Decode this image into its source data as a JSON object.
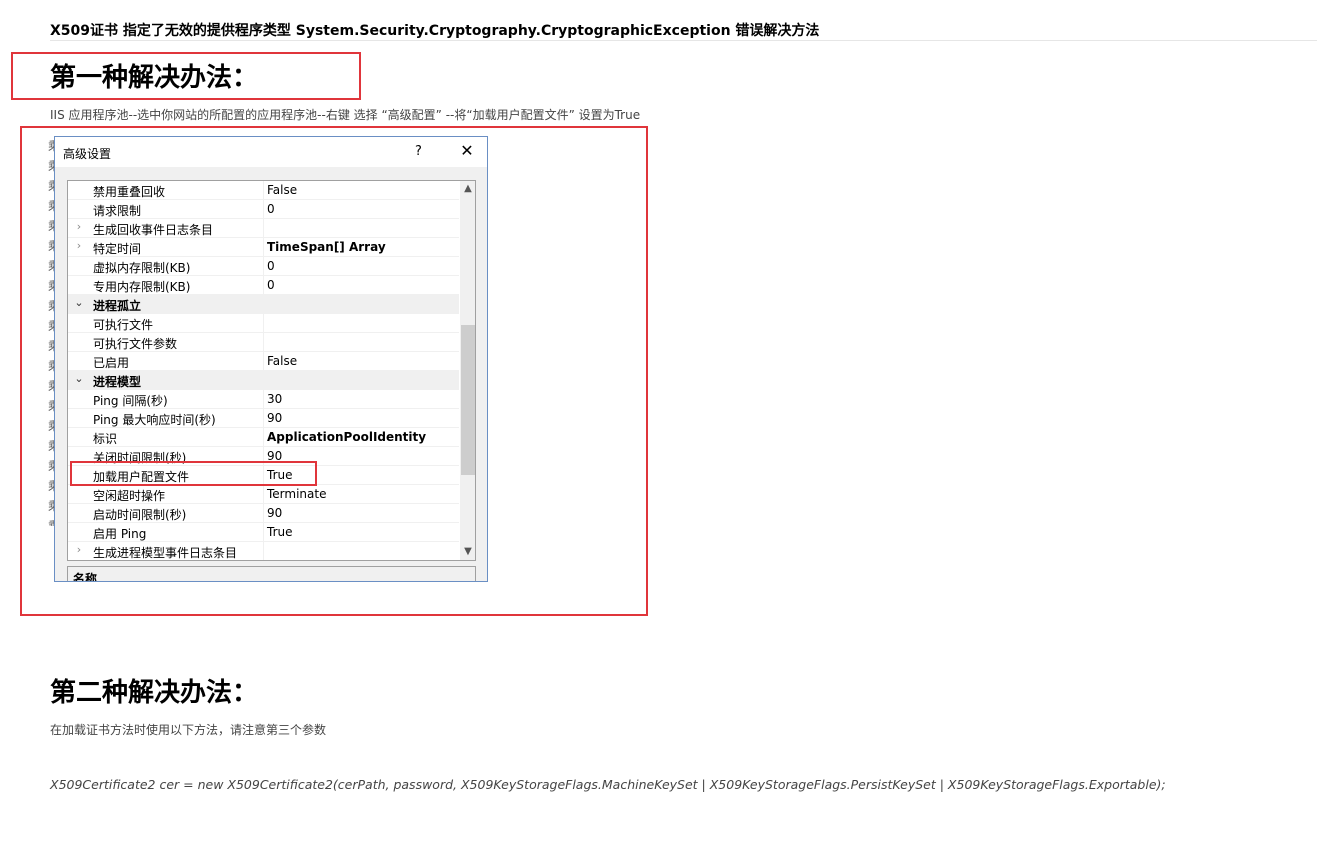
{
  "article": {
    "title": "X509证书 指定了无效的提供程序类型 System.Security.Cryptography.CryptographicException 错误解决方法",
    "section1_heading": "第一种解决办法：",
    "section1_text": "IIS 应用程序池--选中你网站的所配置的应用程序池--右键 选择 “高级配置” --将“加载用户配置文件” 设置为True",
    "section2_heading": "第二种解决办法：",
    "section2_text": "在加载证书方法时使用以下方法，请注意第三个参数",
    "code": "X509Certificate2 cer = new X509Certificate2(cerPath, password, X509KeyStorageFlags.MachineKeySet | X509KeyStorageFlags.PersistKeySet | X509KeyStorageFlags.Exportable);"
  },
  "background_chars": [
    "乘",
    "乘",
    "乘",
    "乘",
    "乘",
    "乘",
    "乘",
    "乘",
    "乘",
    "乘",
    "乘",
    "乘",
    "乘",
    "乘",
    "乘",
    "乘",
    "乘",
    "乘",
    "乘",
    "乘"
  ],
  "dialog": {
    "title": "高级设置",
    "help_glyph": "?",
    "close_glyph": "✕",
    "rows": [
      {
        "expander": "",
        "name": "禁用重叠回收",
        "value": "False",
        "kind": "prop"
      },
      {
        "expander": "",
        "name": "请求限制",
        "value": "0",
        "kind": "prop"
      },
      {
        "expander": ">",
        "name": "生成回收事件日志条目",
        "value": "",
        "kind": "prop"
      },
      {
        "expander": ">",
        "name": "特定时间",
        "value": "TimeSpan[] Array",
        "kind": "bold"
      },
      {
        "expander": "",
        "name": "虚拟内存限制(KB)",
        "value": "0",
        "kind": "prop"
      },
      {
        "expander": "",
        "name": "专用内存限制(KB)",
        "value": "0",
        "kind": "prop"
      },
      {
        "expander": "v",
        "name": "进程孤立",
        "value": "",
        "kind": "cat"
      },
      {
        "expander": "",
        "name": "可执行文件",
        "value": "",
        "kind": "prop"
      },
      {
        "expander": "",
        "name": "可执行文件参数",
        "value": "",
        "kind": "prop"
      },
      {
        "expander": "",
        "name": "已启用",
        "value": "False",
        "kind": "prop"
      },
      {
        "expander": "v",
        "name": "进程模型",
        "value": "",
        "kind": "cat"
      },
      {
        "expander": "",
        "name": "Ping 间隔(秒)",
        "value": "30",
        "kind": "prop"
      },
      {
        "expander": "",
        "name": "Ping 最大响应时间(秒)",
        "value": "90",
        "kind": "prop"
      },
      {
        "expander": "",
        "name": "标识",
        "value": "ApplicationPoolIdentity",
        "kind": "bold"
      },
      {
        "expander": "",
        "name": "关闭时间限制(秒)",
        "value": "90",
        "kind": "prop"
      },
      {
        "expander": "",
        "name": "加载用户配置文件",
        "value": "True",
        "kind": "prop"
      },
      {
        "expander": "",
        "name": "空闲超时操作",
        "value": "Terminate",
        "kind": "prop"
      },
      {
        "expander": "",
        "name": "启动时间限制(秒)",
        "value": "90",
        "kind": "prop"
      },
      {
        "expander": "",
        "name": "启用 Ping",
        "value": "True",
        "kind": "prop"
      },
      {
        "expander": ">",
        "name": "生成进程模型事件日志条目",
        "value": "",
        "kind": "prop"
      }
    ],
    "scroll_up_glyph": "▲",
    "scroll_down_glyph": "▼",
    "desc_title": "名称"
  },
  "colors": {
    "highlight_border": "#e0353b",
    "dialog_border": "#6a8fc4"
  }
}
